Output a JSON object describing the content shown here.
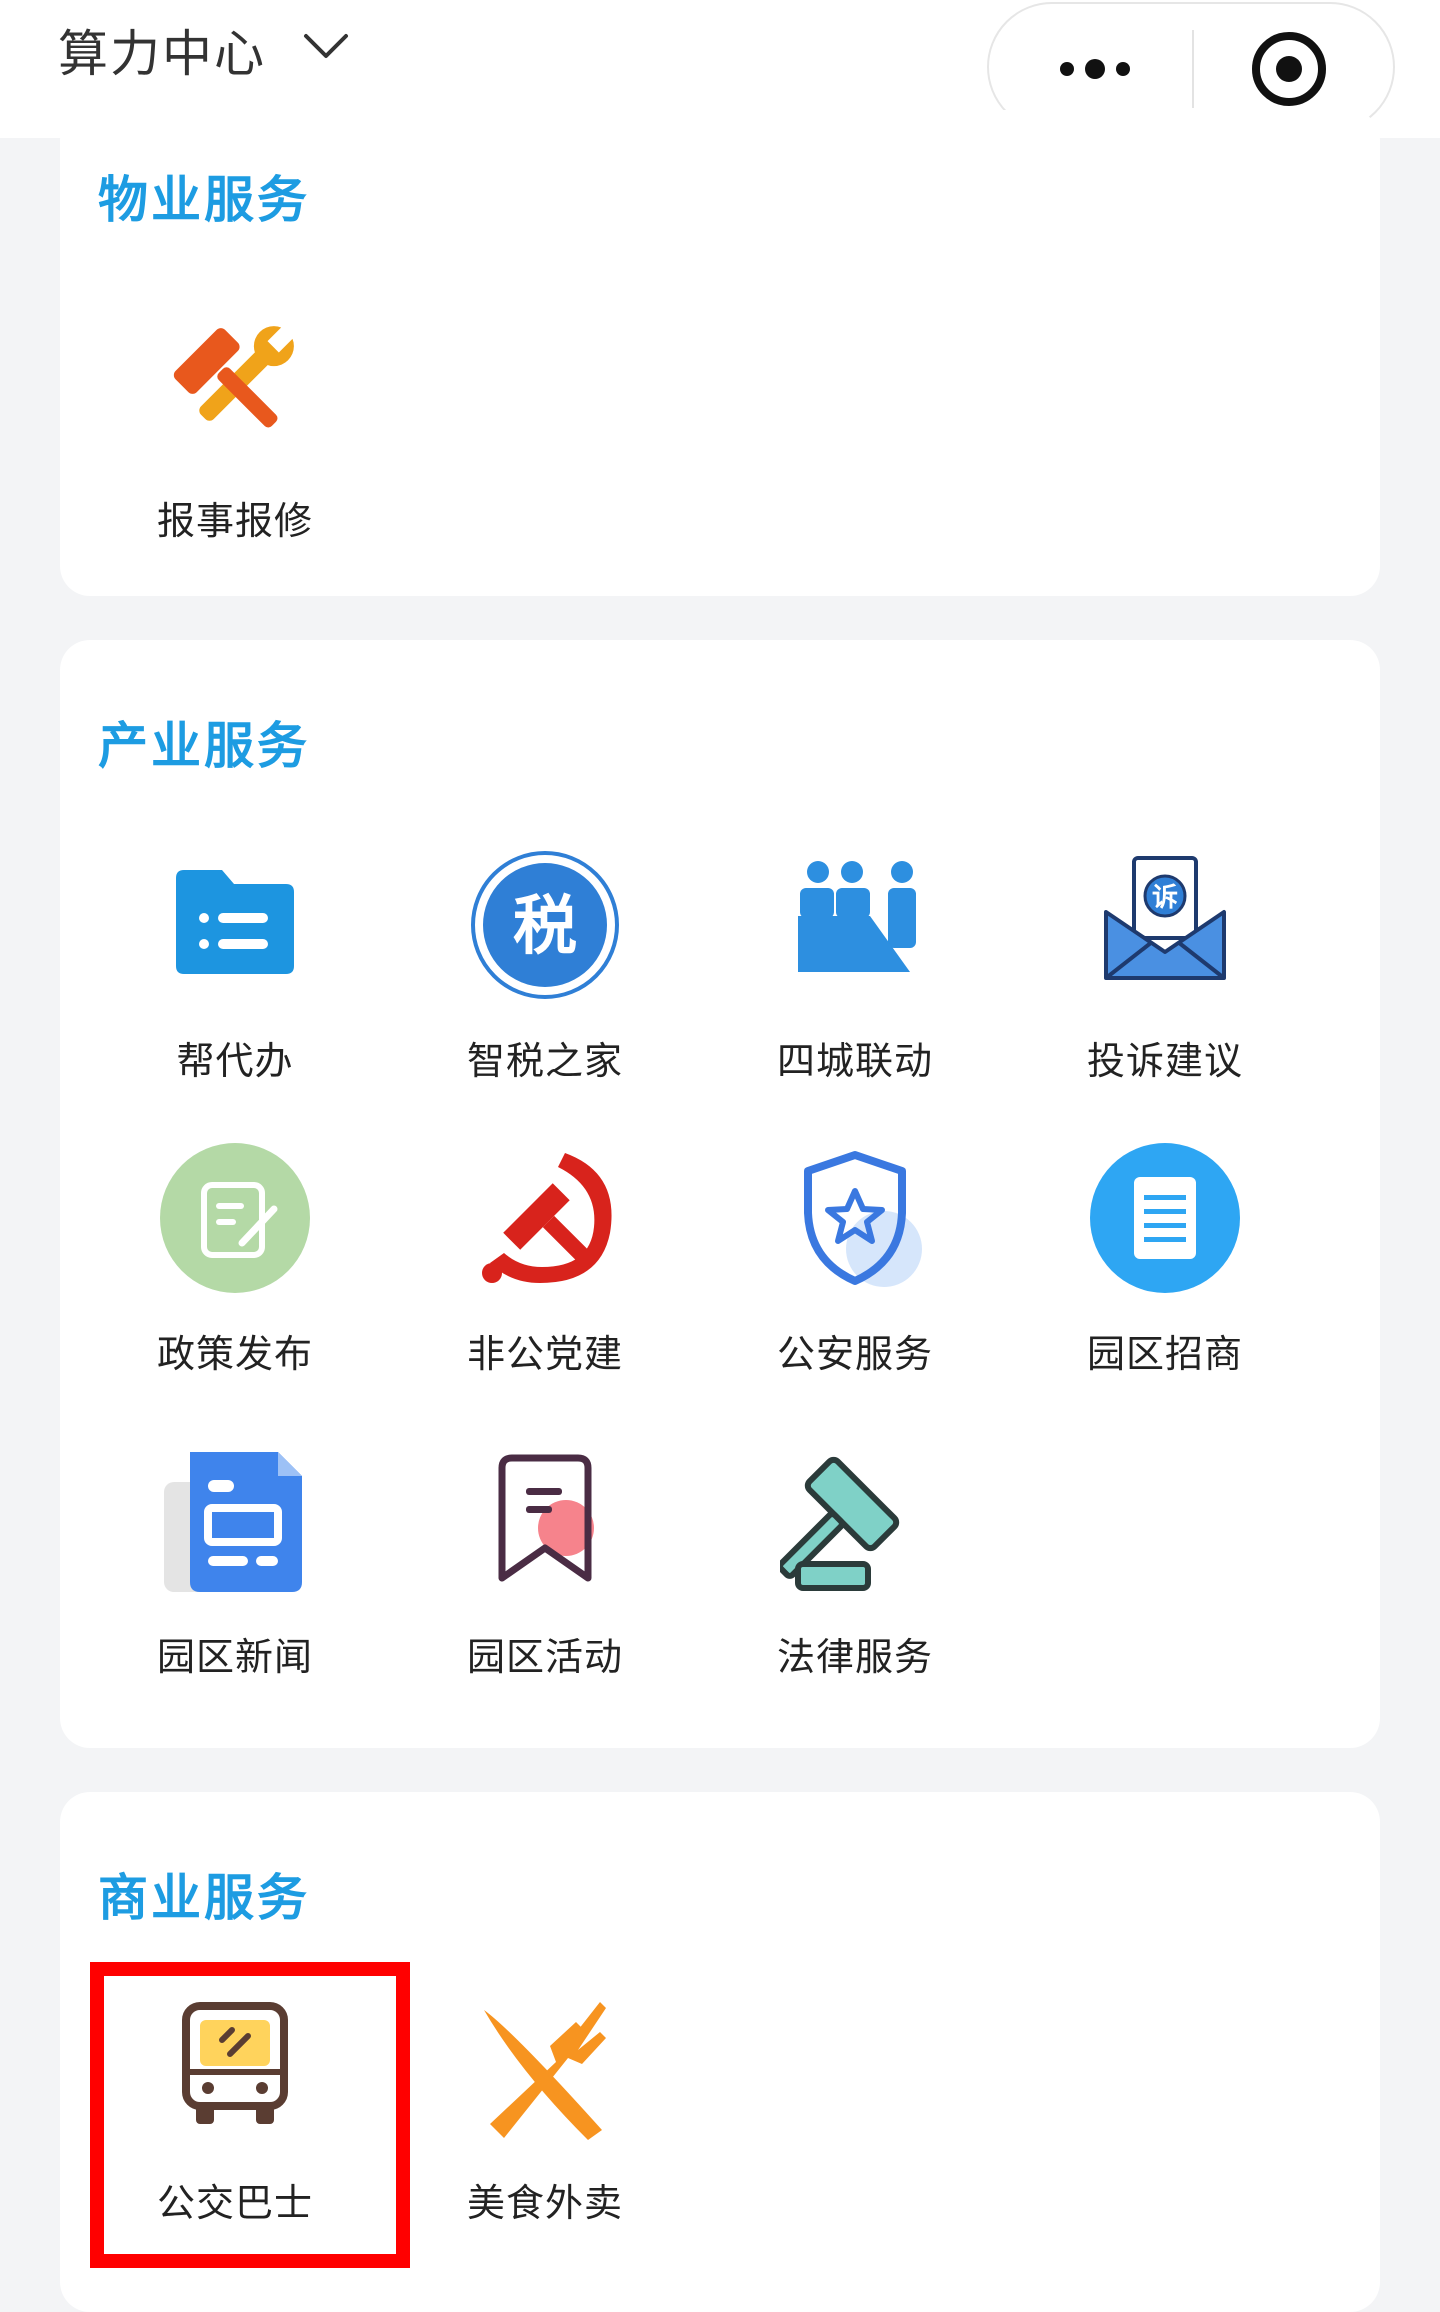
{
  "header": {
    "app_title": "算力中心",
    "dropdown_icon": "chevron-down-icon",
    "more_icon": "more-dots-icon",
    "target_icon": "target-icon"
  },
  "sections": [
    {
      "title": "物业服务",
      "items": [
        {
          "label": "报事报修",
          "icon": "tools-icon"
        }
      ]
    },
    {
      "title": "产业服务",
      "items": [
        {
          "label": "帮代办",
          "icon": "folder-icon"
        },
        {
          "label": "智税之家",
          "icon": "tax-icon",
          "glyph": "税"
        },
        {
          "label": "四城联动",
          "icon": "people-icon"
        },
        {
          "label": "投诉建议",
          "icon": "complaint-icon",
          "glyph": "诉"
        },
        {
          "label": "政策发布",
          "icon": "policy-icon"
        },
        {
          "label": "非公党建",
          "icon": "party-icon"
        },
        {
          "label": "公安服务",
          "icon": "police-icon"
        },
        {
          "label": "园区招商",
          "icon": "document-icon"
        },
        {
          "label": "园区新闻",
          "icon": "news-icon"
        },
        {
          "label": "园区活动",
          "icon": "activity-icon"
        },
        {
          "label": "法律服务",
          "icon": "gavel-icon"
        }
      ]
    },
    {
      "title": "商业服务",
      "items": [
        {
          "label": "公交巴士",
          "icon": "bus-icon"
        },
        {
          "label": "美食外卖",
          "icon": "food-icon"
        }
      ]
    }
  ],
  "colors": {
    "section_title": "#1d9ce2",
    "highlight_border": "#ff0000",
    "background": "#f3f4f6"
  }
}
